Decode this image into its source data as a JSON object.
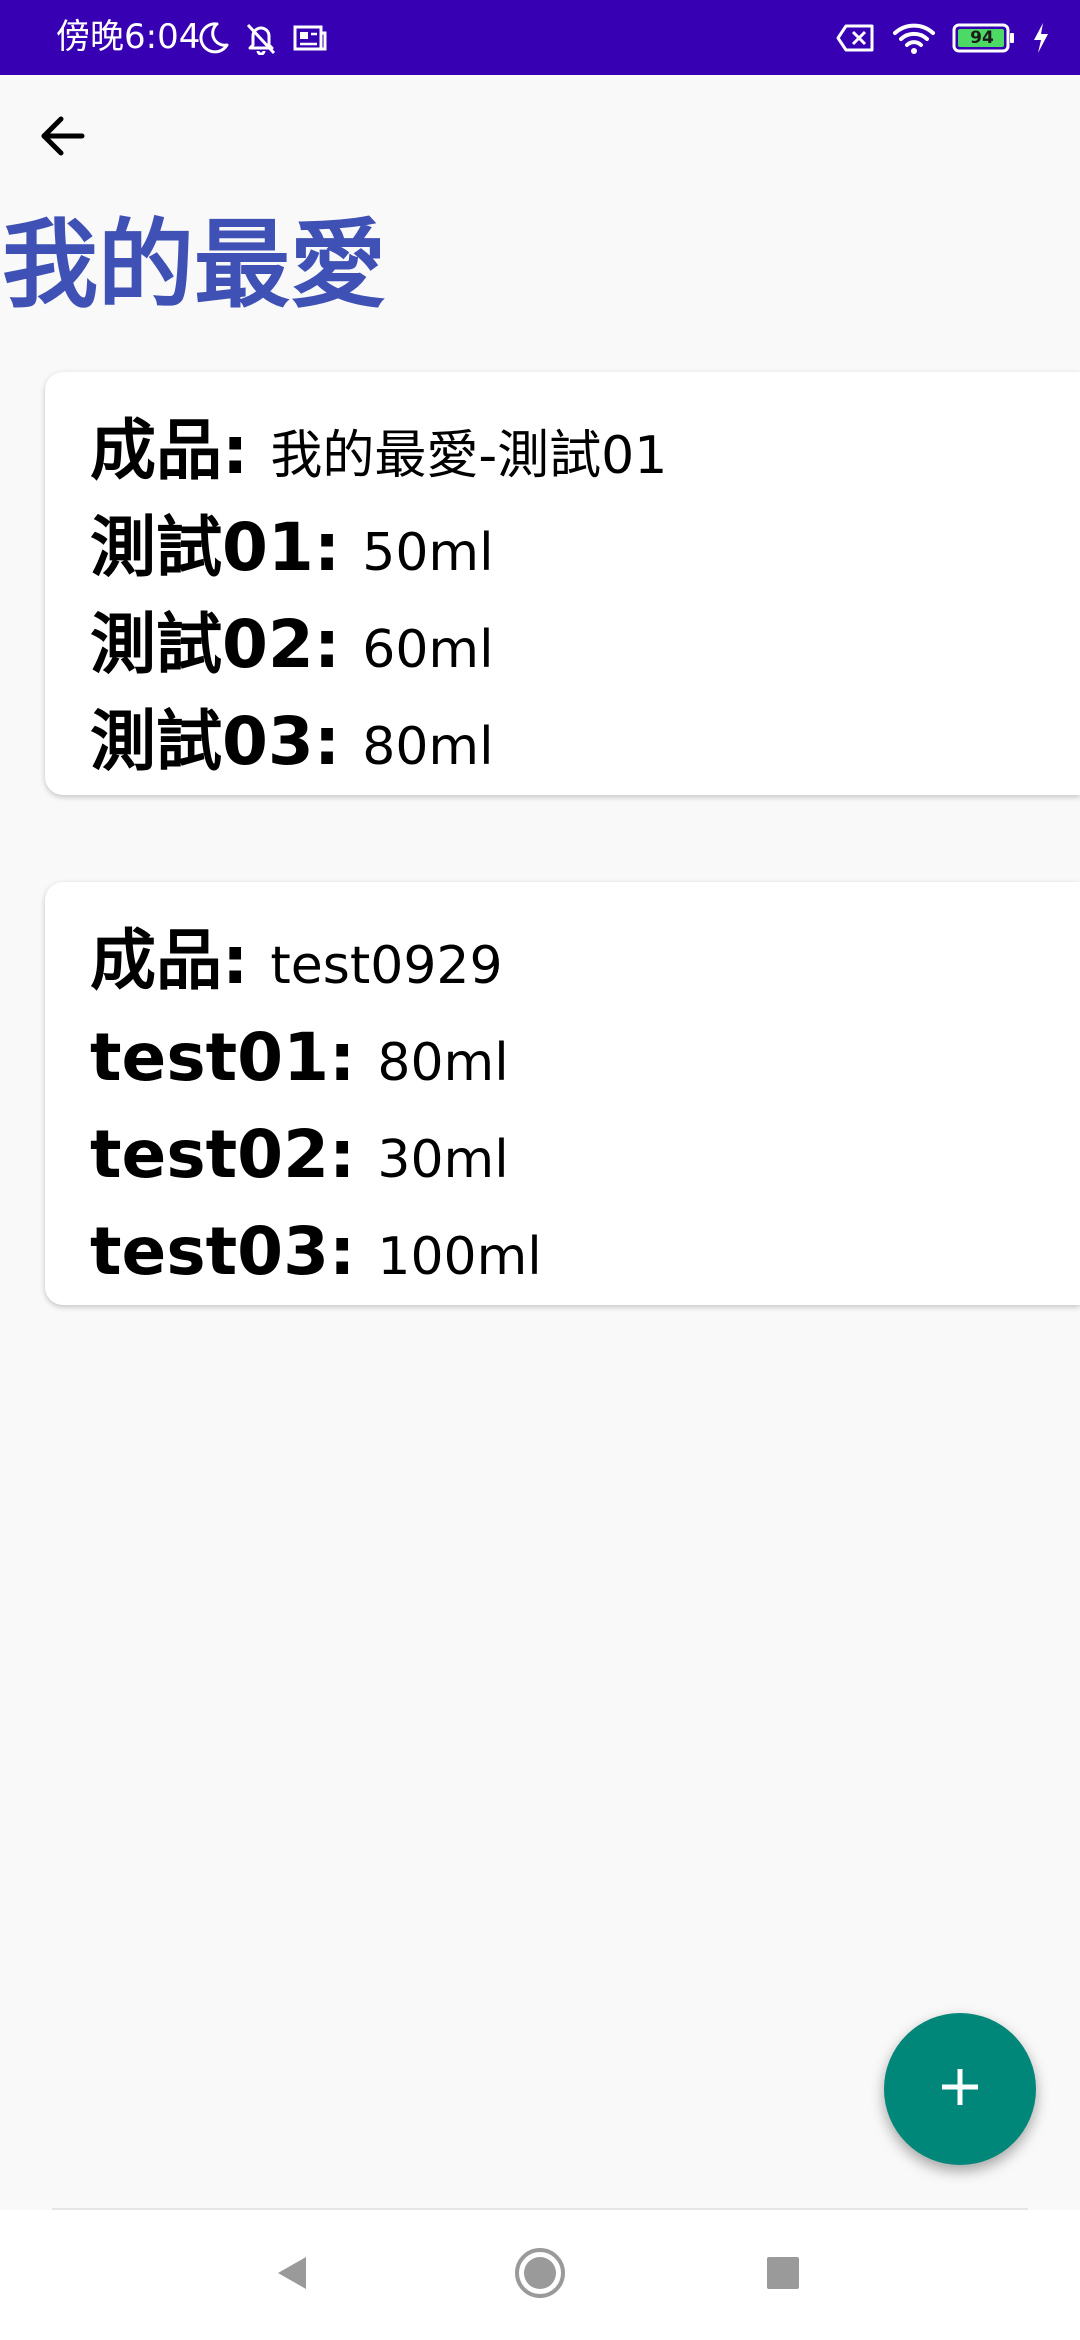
{
  "status_bar": {
    "time": "傍晚6:04",
    "battery_level": "94",
    "bg_color": "#3700b3",
    "icons_left": [
      "moon-icon",
      "bell-off-icon",
      "news-icon"
    ],
    "icons_right": [
      "no-sim-icon",
      "wifi-icon",
      "battery-icon",
      "charging-icon"
    ]
  },
  "app_bar": {
    "back_icon": "arrow-left-icon",
    "title": "我的最愛",
    "title_color": "#3f51b5"
  },
  "cards": [
    {
      "rows": [
        {
          "label": "成品:",
          "value": "我的最愛-測試01"
        },
        {
          "label": "測試01:",
          "value": "50ml"
        },
        {
          "label": "測試02:",
          "value": "60ml"
        },
        {
          "label": "測試03:",
          "value": "80ml"
        }
      ]
    },
    {
      "rows": [
        {
          "label": "成品:",
          "value": "test0929"
        },
        {
          "label": "test01:",
          "value": "80ml"
        },
        {
          "label": "test02:",
          "value": "30ml"
        },
        {
          "label": "test03:",
          "value": "100ml"
        }
      ]
    }
  ],
  "fab": {
    "icon": "plus-icon",
    "color": "#01877a"
  },
  "nav_bar": {
    "buttons": [
      "nav-back-icon",
      "nav-home-icon",
      "nav-recents-icon"
    ]
  }
}
